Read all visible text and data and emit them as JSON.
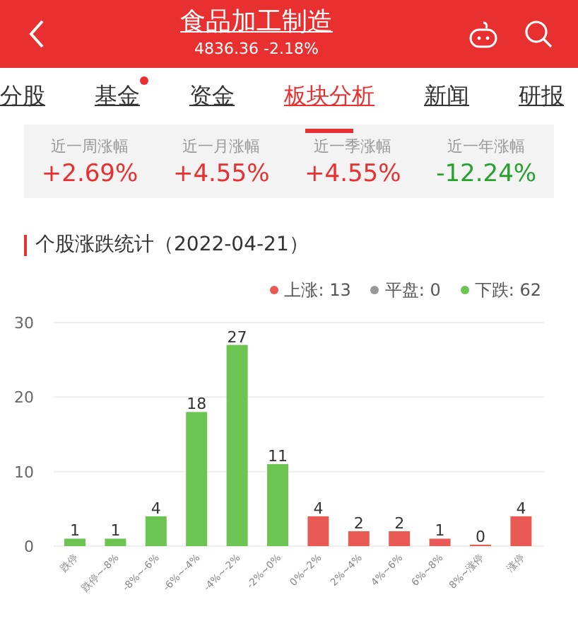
{
  "header": {
    "title": "食品加工制造",
    "subtitle": "4836.36 -2.18%"
  },
  "tabs": [
    {
      "label": "分股",
      "selected": false,
      "badge": false
    },
    {
      "label": "基金",
      "selected": false,
      "badge": true
    },
    {
      "label": "资金",
      "selected": false,
      "badge": false
    },
    {
      "label": "板块分析",
      "selected": true,
      "badge": false
    },
    {
      "label": "新闻",
      "selected": false,
      "badge": false
    },
    {
      "label": "研报",
      "selected": false,
      "badge": false
    }
  ],
  "stats": [
    {
      "label": "近一周涨幅",
      "value": "+2.69%",
      "kind": "up"
    },
    {
      "label": "近一月涨幅",
      "value": "+4.55%",
      "kind": "up"
    },
    {
      "label": "近一季涨幅",
      "value": "+4.55%",
      "kind": "up"
    },
    {
      "label": "近一年涨幅",
      "value": "-12.24%",
      "kind": "down"
    }
  ],
  "section": {
    "title": "个股涨跌统计（2022-04-21）"
  },
  "legend": [
    {
      "count": ": 13"
    },
    {
      "count": ": 0"
    },
    {
      "count": ": 62"
    }
  ],
  "chart_data": {
    "type": "bar",
    "stacked": true,
    "data_labels": true,
    "ylim": [
      0,
      30
    ],
    "yticks": [
      0,
      10,
      20,
      30
    ],
    "categories": [
      "跌停",
      "跌停~-8%",
      "-8%~-6%",
      "-6%~-4%",
      "-4%~-2%",
      "-2%~0%",
      "0%~2%",
      "2%~4%",
      "4%~6%",
      "6%~8%",
      "8%~涨停",
      "涨停"
    ],
    "series": [
      {
        "name": "上涨",
        "color": "#e95a55",
        "values": [
          null,
          null,
          null,
          null,
          null,
          null,
          4,
          2,
          2,
          1,
          0,
          4
        ]
      },
      {
        "name": "平盘",
        "color": "#999999",
        "values": [
          null,
          null,
          null,
          null,
          null,
          null,
          null,
          null,
          null,
          null,
          null,
          null
        ]
      },
      {
        "name": "下跌",
        "color": "#6cc551",
        "values": [
          1,
          1,
          4,
          18,
          27,
          11,
          null,
          null,
          null,
          null,
          null,
          null
        ]
      }
    ]
  }
}
